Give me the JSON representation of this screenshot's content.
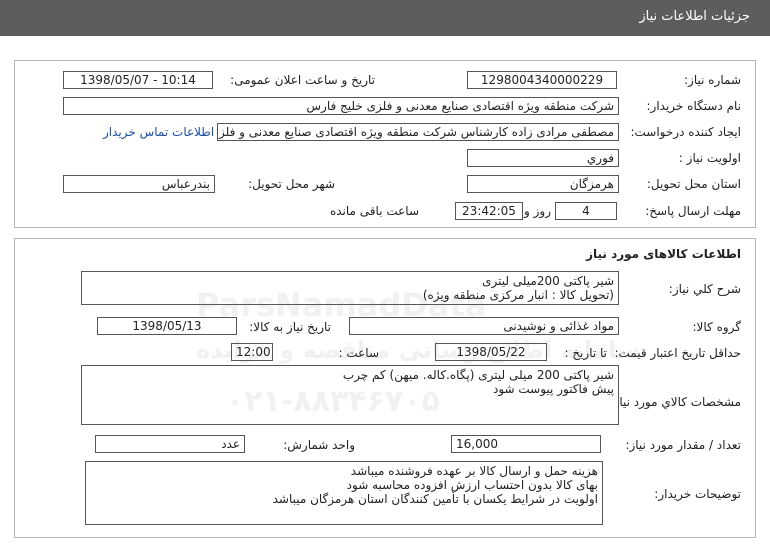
{
  "header": {
    "title": "جزئیات اطلاعات نیاز"
  },
  "info": {
    "need_number_label": "شماره نیاز:",
    "need_number": "1298004340000229",
    "announce_label": "تاریخ و ساعت اعلان عمومی:",
    "announce_value": "1398/05/07 - 10:14",
    "buyer_label": "نام دستگاه خریدار:",
    "buyer_value": "شرکت منطقه ویژه اقتصادی صنایع معدنی و فلزی خلیج فارس",
    "requester_label": "ایجاد کننده درخواست:",
    "requester_value": "مصطفی مرادی زاده کارشناس شرکت منطقه ویژه اقتصادی صنایع معدنی و فلزی",
    "contact_link": "اطلاعات تماس خریدار",
    "priority_label": "اولویت نیاز :",
    "priority_value": "فوري",
    "province_label": "استان محل تحویل:",
    "province_value": "هرمزگان",
    "city_label": "شهر محل تحویل:",
    "city_value": "بندرعباس",
    "deadline_label": "مهلت ارسال پاسخ:",
    "days_value": "4",
    "days_unit": "روز و",
    "time_value": "23:42:05",
    "remaining_label": "ساعت باقی مانده"
  },
  "goods": {
    "section_title": "اطلاعات کالاهای مورد نیاز",
    "desc_label": "شرح کلي نیاز:",
    "desc_line1": "شیر پاکتی 200میلی لیتری",
    "desc_line2": "(تحویل کالا : انبار مرکزی منطقه ویژه)",
    "group_label": "گروه کالا:",
    "group_value": "مواد غذائی و نوشیدنی",
    "need_date_label": "تاریخ نیاز به کالا:",
    "need_date_value": "1398/05/13",
    "validity_label": "حداقل تاریخ اعتبار قیمت:",
    "until_label": "تا تاریخ :",
    "until_date": "1398/05/22",
    "hour_label": "ساعت :",
    "hour_value": "12:00",
    "spec_label": "مشخصات کالاي مورد نیاز:",
    "spec_line1": "شیر پاکتی 200 میلی لیتری (پگاه.کاله. میهن) کم چرب",
    "spec_line2": "پیش فاکتور پیوست شود",
    "qty_label": "تعداد / مقدار مورد نیاز:",
    "qty_value": "16,000",
    "unit_label": "واحد شمارش:",
    "unit_value": "عدد",
    "notes_label": "توضیحات خریدار:",
    "notes_line1": "هزینه حمل و ارسال کالا بر عهده فروشنده میباشد",
    "notes_line2": "بهای کالا بدون احتساب ارزش افزوده محاسبه شود",
    "notes_line3": "اولویت در شرایط یکسان با تأمین کنندگان استان هرمزگان میباشد"
  },
  "watermark": {
    "brand": "ParsNamadData",
    "line1": "سامانه اطلاع رسانی مناقصه و مزایده",
    "phone": "۰۲۱-۸۸۳۴۶۷۰۵"
  },
  "colors": {
    "header_bg": "#5d5d5d",
    "link": "#1a4fa0",
    "border": "#555555"
  }
}
